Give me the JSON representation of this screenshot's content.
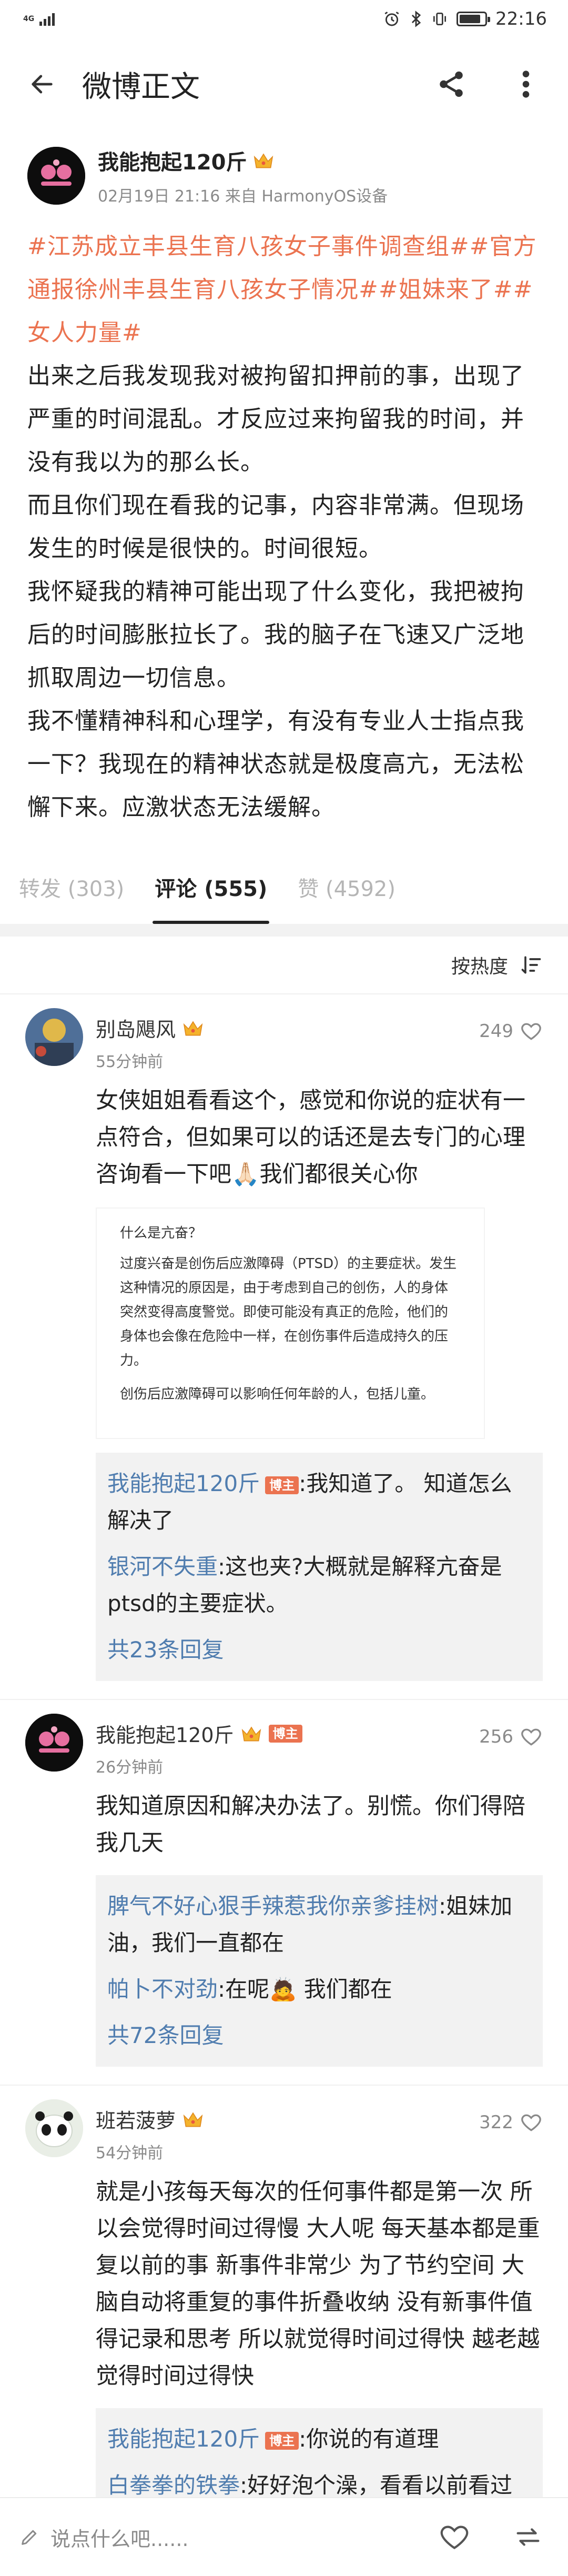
{
  "status_bar": {
    "network": "4G",
    "time": "22:16",
    "battery_level": 0.85
  },
  "nav": {
    "title": "微博正文"
  },
  "post": {
    "author": "我能抱起120斤",
    "meta": "02月19日 21:16 来自 HarmonyOS设备",
    "hashtags": "#江苏成立丰县生育八孩女子事件调查组##官方通报徐州丰县生育八孩女子情况##姐妹来了##女人力量#",
    "lines": [
      "出来之后我发现我对被拘留扣押前的事，出现了严重的时间混乱。才反应过来拘留我的时间，并没有我以为的那么长。",
      "而且你们现在看我的记事，内容非常满。但现场发生的时候是很快的。时间很短。",
      "我怀疑我的精神可能出现了什么变化，我把被拘后的时间膨胀拉长了。我的脑子在飞速又广泛地抓取周边一切信息。",
      "我不懂精神科和心理学，有没有专业人士指点我一下？我现在的精神状态就是极度高亢，无法松懈下来。应激状态无法缓解。"
    ]
  },
  "tabs": [
    {
      "label": "转发 (303)"
    },
    {
      "label": "评论 (555)"
    },
    {
      "label": "赞 (4592)"
    }
  ],
  "sort": {
    "label": "按热度"
  },
  "comments": [
    {
      "name": "别岛飓风",
      "time": "55分钟前",
      "likes": "249",
      "text": "女侠姐姐看看这个，感觉和你说的症状有一点符合，但如果可以的话还是去专门的心理咨询看一下吧🙏🏻我们都很关心你",
      "attachment": {
        "title": "什么是亢奋？",
        "p1": "过度兴奋是创伤后应激障碍（PTSD）的主要症状。发生这种情况的原因是，由于考虑到自己的创伤，人的身体突然变得高度警觉。即使可能没有真正的危险，他们的身体也会像在危险中一样，在创伤事件后造成持久的压力。",
        "p2": "创伤后应激障碍可以影响任何年龄的人，包括儿童。"
      },
      "replies": [
        {
          "user": "我能抱起120斤",
          "badge": "博主",
          "text": ":我知道了。 知道怎么解决了"
        },
        {
          "user": "银河不失重",
          "badge": "",
          "text": ":这也夹?大概就是解释亢奋是ptsd的主要症状。"
        }
      ],
      "more": "共23条回复"
    },
    {
      "name": "我能抱起120斤",
      "badge": "博主",
      "time": "26分钟前",
      "likes": "256",
      "text": "我知道原因和解决办法了。别慌。你们得陪我几天",
      "replies": [
        {
          "user": "脾气不好心狠手辣惹我你亲爹挂树",
          "badge": "",
          "text": ":姐妹加油，我们一直都在"
        },
        {
          "user": "帕卜不对劲",
          "badge": "",
          "text": ":在呢🙇 我们都在"
        }
      ],
      "more": "共72条回复"
    },
    {
      "name": "班若菠萝",
      "time": "54分钟前",
      "likes": "322",
      "text": "就是小孩每天每次的任何事件都是第一次 所以会觉得时间过得慢  大人呢 每天基本都是重复以前的事 新事件非常少 为了节约空间 大脑自动将重复的事件折叠收纳 没有新事件值得记录和思考 所以就觉得时间过得快  越老越觉得时间过得快",
      "replies": [
        {
          "user": "我能抱起120斤",
          "badge": "博主",
          "text": ":你说的有道理"
        },
        {
          "user": "白拳拳的铁拳",
          "badge": "",
          "text": ":好好泡个澡，看看以前看过并且喜欢的电视和书，做个瑜伽，按时吃饭，锻炼身体，你有这么强大的内心，会很快恢复起来的！"
        }
      ]
    }
  ],
  "bottom_bar": {
    "input_placeholder": "说点什么吧......"
  },
  "colors": {
    "accent": "#eb7350",
    "link": "#507daf"
  }
}
